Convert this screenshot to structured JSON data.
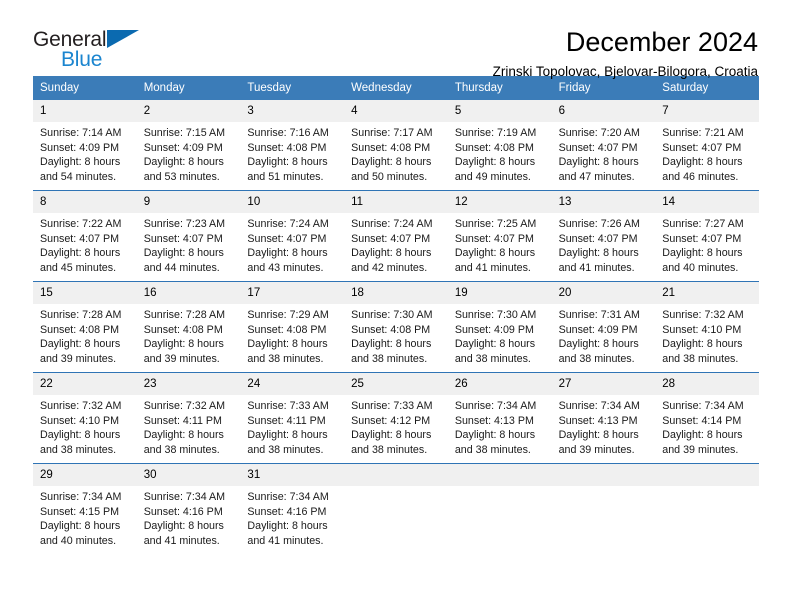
{
  "brand": {
    "name_part1": "General",
    "name_part2": "Blue",
    "triangle_color": "#0b6ab0",
    "blue_color": "#1b85cf"
  },
  "header": {
    "title": "December 2024",
    "subtitle": "Zrinski Topolovac, Bjelovar-Bilogora, Croatia"
  },
  "theme": {
    "header_row_bg": "#3b7cb8",
    "week_divider": "#2f74b5",
    "day_number_bg": "#f0f0f0",
    "text": "#000000"
  },
  "weekdays": [
    "Sunday",
    "Monday",
    "Tuesday",
    "Wednesday",
    "Thursday",
    "Friday",
    "Saturday"
  ],
  "weeks": [
    [
      {
        "day": "1",
        "sunrise": "Sunrise: 7:14 AM",
        "sunset": "Sunset: 4:09 PM",
        "daylight1": "Daylight: 8 hours",
        "daylight2": "and 54 minutes."
      },
      {
        "day": "2",
        "sunrise": "Sunrise: 7:15 AM",
        "sunset": "Sunset: 4:09 PM",
        "daylight1": "Daylight: 8 hours",
        "daylight2": "and 53 minutes."
      },
      {
        "day": "3",
        "sunrise": "Sunrise: 7:16 AM",
        "sunset": "Sunset: 4:08 PM",
        "daylight1": "Daylight: 8 hours",
        "daylight2": "and 51 minutes."
      },
      {
        "day": "4",
        "sunrise": "Sunrise: 7:17 AM",
        "sunset": "Sunset: 4:08 PM",
        "daylight1": "Daylight: 8 hours",
        "daylight2": "and 50 minutes."
      },
      {
        "day": "5",
        "sunrise": "Sunrise: 7:19 AM",
        "sunset": "Sunset: 4:08 PM",
        "daylight1": "Daylight: 8 hours",
        "daylight2": "and 49 minutes."
      },
      {
        "day": "6",
        "sunrise": "Sunrise: 7:20 AM",
        "sunset": "Sunset: 4:07 PM",
        "daylight1": "Daylight: 8 hours",
        "daylight2": "and 47 minutes."
      },
      {
        "day": "7",
        "sunrise": "Sunrise: 7:21 AM",
        "sunset": "Sunset: 4:07 PM",
        "daylight1": "Daylight: 8 hours",
        "daylight2": "and 46 minutes."
      }
    ],
    [
      {
        "day": "8",
        "sunrise": "Sunrise: 7:22 AM",
        "sunset": "Sunset: 4:07 PM",
        "daylight1": "Daylight: 8 hours",
        "daylight2": "and 45 minutes."
      },
      {
        "day": "9",
        "sunrise": "Sunrise: 7:23 AM",
        "sunset": "Sunset: 4:07 PM",
        "daylight1": "Daylight: 8 hours",
        "daylight2": "and 44 minutes."
      },
      {
        "day": "10",
        "sunrise": "Sunrise: 7:24 AM",
        "sunset": "Sunset: 4:07 PM",
        "daylight1": "Daylight: 8 hours",
        "daylight2": "and 43 minutes."
      },
      {
        "day": "11",
        "sunrise": "Sunrise: 7:24 AM",
        "sunset": "Sunset: 4:07 PM",
        "daylight1": "Daylight: 8 hours",
        "daylight2": "and 42 minutes."
      },
      {
        "day": "12",
        "sunrise": "Sunrise: 7:25 AM",
        "sunset": "Sunset: 4:07 PM",
        "daylight1": "Daylight: 8 hours",
        "daylight2": "and 41 minutes."
      },
      {
        "day": "13",
        "sunrise": "Sunrise: 7:26 AM",
        "sunset": "Sunset: 4:07 PM",
        "daylight1": "Daylight: 8 hours",
        "daylight2": "and 41 minutes."
      },
      {
        "day": "14",
        "sunrise": "Sunrise: 7:27 AM",
        "sunset": "Sunset: 4:07 PM",
        "daylight1": "Daylight: 8 hours",
        "daylight2": "and 40 minutes."
      }
    ],
    [
      {
        "day": "15",
        "sunrise": "Sunrise: 7:28 AM",
        "sunset": "Sunset: 4:08 PM",
        "daylight1": "Daylight: 8 hours",
        "daylight2": "and 39 minutes."
      },
      {
        "day": "16",
        "sunrise": "Sunrise: 7:28 AM",
        "sunset": "Sunset: 4:08 PM",
        "daylight1": "Daylight: 8 hours",
        "daylight2": "and 39 minutes."
      },
      {
        "day": "17",
        "sunrise": "Sunrise: 7:29 AM",
        "sunset": "Sunset: 4:08 PM",
        "daylight1": "Daylight: 8 hours",
        "daylight2": "and 38 minutes."
      },
      {
        "day": "18",
        "sunrise": "Sunrise: 7:30 AM",
        "sunset": "Sunset: 4:08 PM",
        "daylight1": "Daylight: 8 hours",
        "daylight2": "and 38 minutes."
      },
      {
        "day": "19",
        "sunrise": "Sunrise: 7:30 AM",
        "sunset": "Sunset: 4:09 PM",
        "daylight1": "Daylight: 8 hours",
        "daylight2": "and 38 minutes."
      },
      {
        "day": "20",
        "sunrise": "Sunrise: 7:31 AM",
        "sunset": "Sunset: 4:09 PM",
        "daylight1": "Daylight: 8 hours",
        "daylight2": "and 38 minutes."
      },
      {
        "day": "21",
        "sunrise": "Sunrise: 7:32 AM",
        "sunset": "Sunset: 4:10 PM",
        "daylight1": "Daylight: 8 hours",
        "daylight2": "and 38 minutes."
      }
    ],
    [
      {
        "day": "22",
        "sunrise": "Sunrise: 7:32 AM",
        "sunset": "Sunset: 4:10 PM",
        "daylight1": "Daylight: 8 hours",
        "daylight2": "and 38 minutes."
      },
      {
        "day": "23",
        "sunrise": "Sunrise: 7:32 AM",
        "sunset": "Sunset: 4:11 PM",
        "daylight1": "Daylight: 8 hours",
        "daylight2": "and 38 minutes."
      },
      {
        "day": "24",
        "sunrise": "Sunrise: 7:33 AM",
        "sunset": "Sunset: 4:11 PM",
        "daylight1": "Daylight: 8 hours",
        "daylight2": "and 38 minutes."
      },
      {
        "day": "25",
        "sunrise": "Sunrise: 7:33 AM",
        "sunset": "Sunset: 4:12 PM",
        "daylight1": "Daylight: 8 hours",
        "daylight2": "and 38 minutes."
      },
      {
        "day": "26",
        "sunrise": "Sunrise: 7:34 AM",
        "sunset": "Sunset: 4:13 PM",
        "daylight1": "Daylight: 8 hours",
        "daylight2": "and 38 minutes."
      },
      {
        "day": "27",
        "sunrise": "Sunrise: 7:34 AM",
        "sunset": "Sunset: 4:13 PM",
        "daylight1": "Daylight: 8 hours",
        "daylight2": "and 39 minutes."
      },
      {
        "day": "28",
        "sunrise": "Sunrise: 7:34 AM",
        "sunset": "Sunset: 4:14 PM",
        "daylight1": "Daylight: 8 hours",
        "daylight2": "and 39 minutes."
      }
    ],
    [
      {
        "day": "29",
        "sunrise": "Sunrise: 7:34 AM",
        "sunset": "Sunset: 4:15 PM",
        "daylight1": "Daylight: 8 hours",
        "daylight2": "and 40 minutes."
      },
      {
        "day": "30",
        "sunrise": "Sunrise: 7:34 AM",
        "sunset": "Sunset: 4:16 PM",
        "daylight1": "Daylight: 8 hours",
        "daylight2": "and 41 minutes."
      },
      {
        "day": "31",
        "sunrise": "Sunrise: 7:34 AM",
        "sunset": "Sunset: 4:16 PM",
        "daylight1": "Daylight: 8 hours",
        "daylight2": "and 41 minutes."
      },
      {
        "day": "",
        "sunrise": "",
        "sunset": "",
        "daylight1": "",
        "daylight2": ""
      },
      {
        "day": "",
        "sunrise": "",
        "sunset": "",
        "daylight1": "",
        "daylight2": ""
      },
      {
        "day": "",
        "sunrise": "",
        "sunset": "",
        "daylight1": "",
        "daylight2": ""
      },
      {
        "day": "",
        "sunrise": "",
        "sunset": "",
        "daylight1": "",
        "daylight2": ""
      }
    ]
  ]
}
